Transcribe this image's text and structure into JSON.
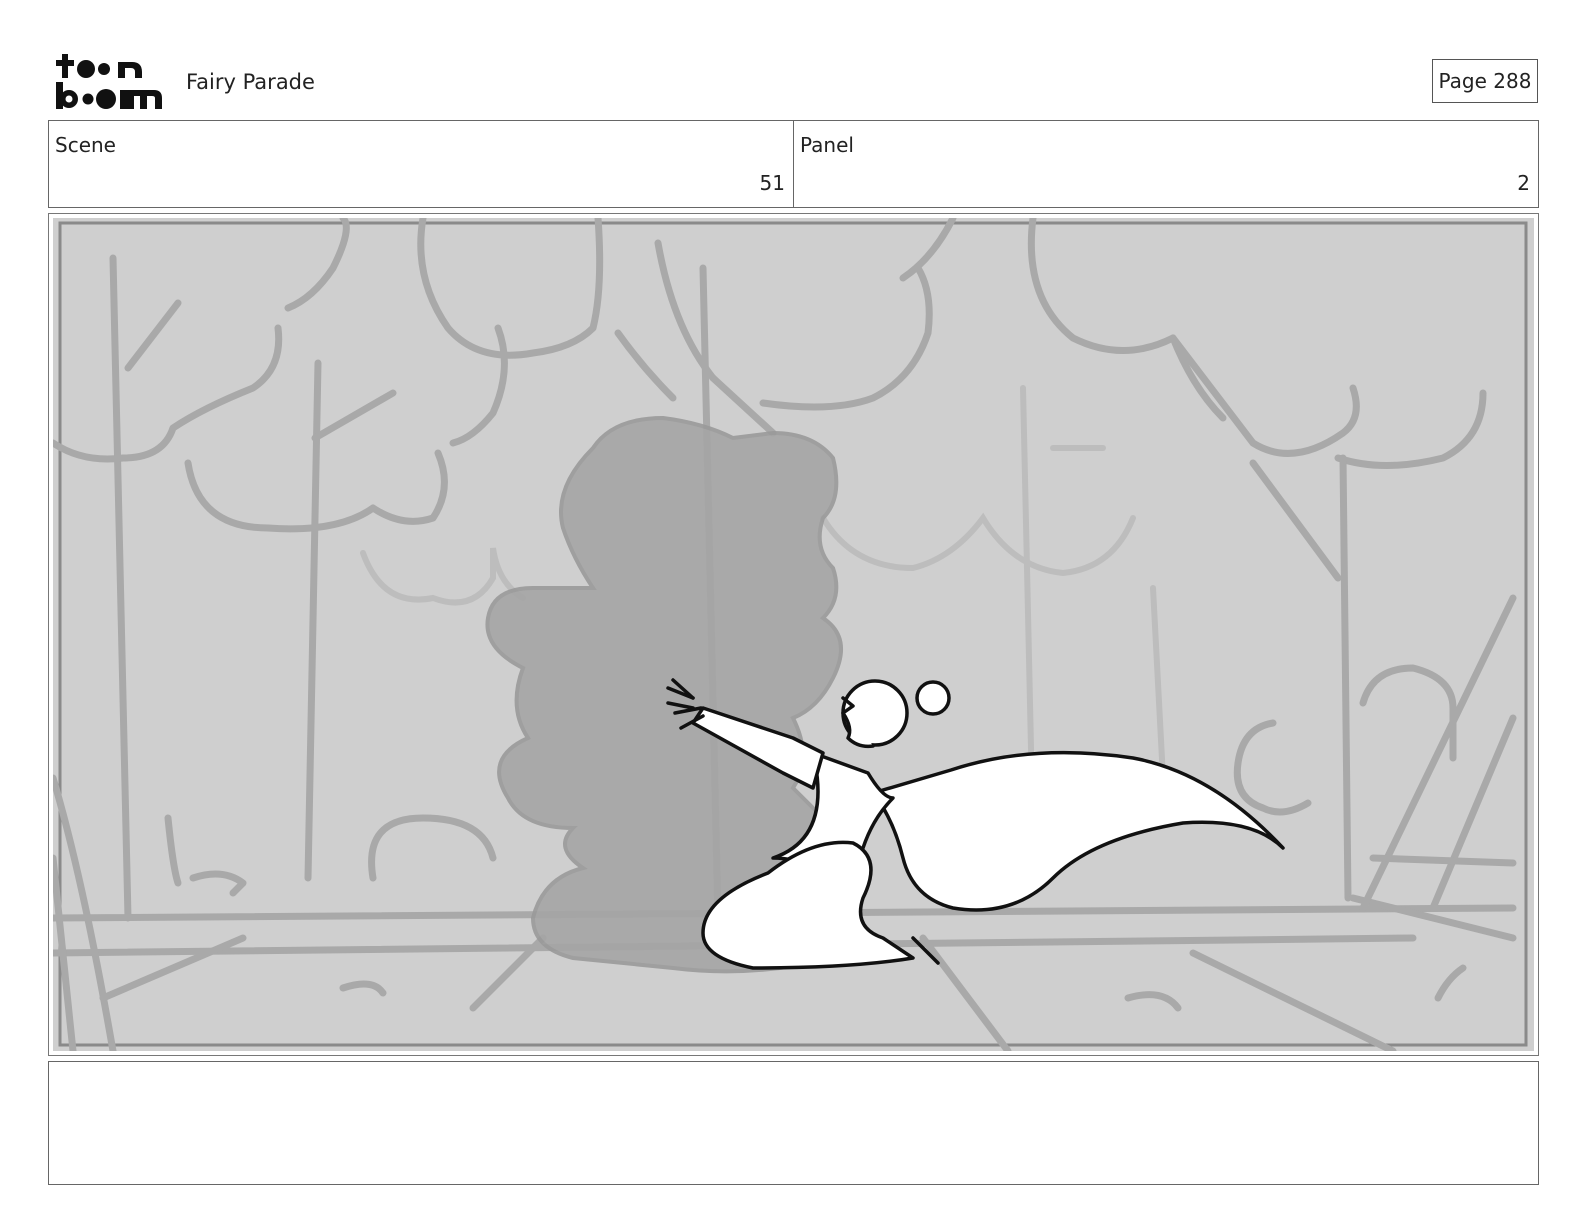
{
  "header": {
    "logo_text": "toon boom",
    "project_title": "Fairy Parade",
    "page_label": "Page 288"
  },
  "info": {
    "scene_label": "Scene",
    "scene_value": "51",
    "panel_label": "Panel",
    "panel_value": "2"
  },
  "panel_image": {
    "description_icon": "storyboard-sketch-image"
  },
  "dialog": {
    "text": ""
  }
}
